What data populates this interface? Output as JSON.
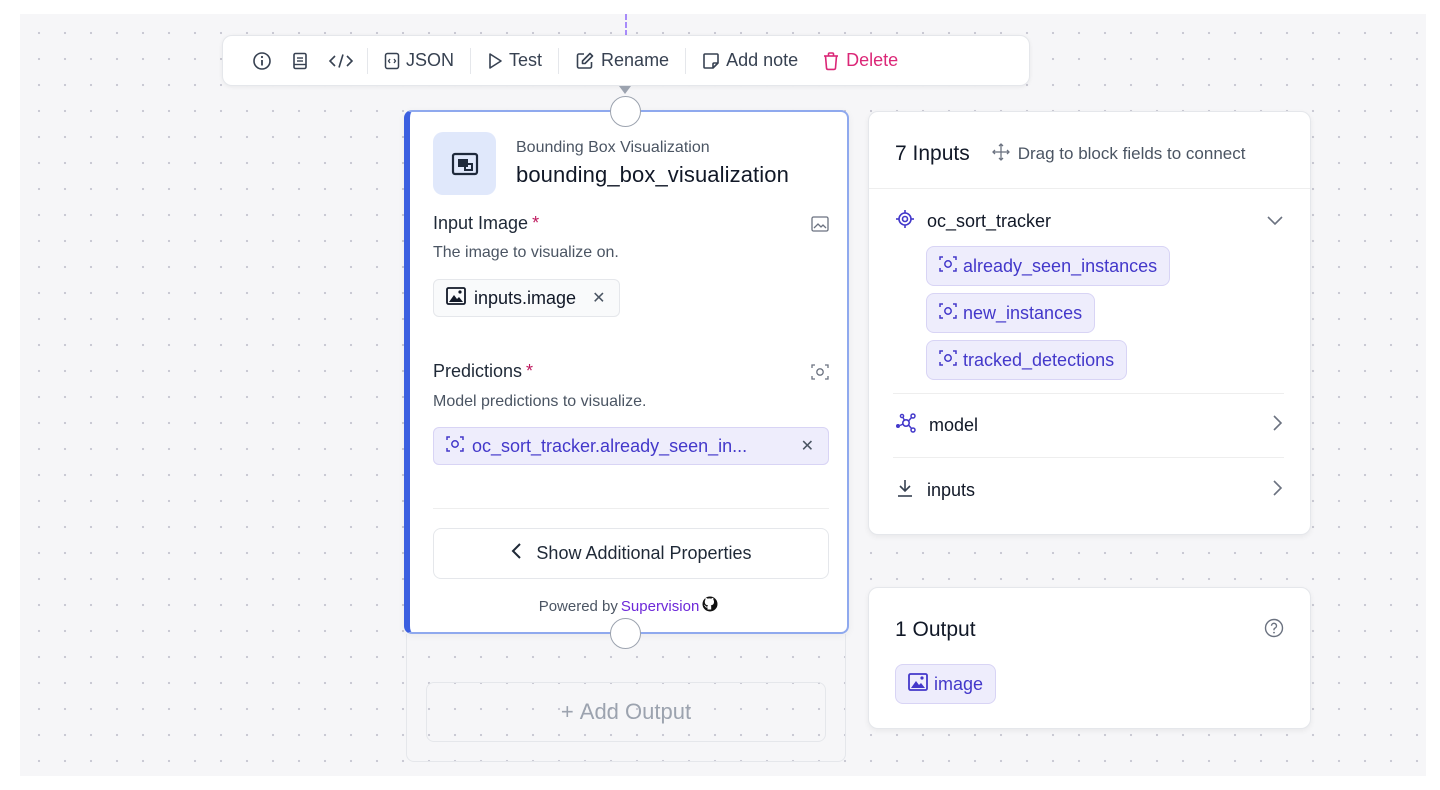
{
  "toolbar": {
    "json_label": "JSON",
    "test_label": "Test",
    "rename_label": "Rename",
    "add_note_label": "Add note",
    "delete_label": "Delete"
  },
  "node": {
    "type_label": "Bounding Box Visualization",
    "name": "bounding_box_visualization",
    "fields": [
      {
        "label": "Input Image",
        "required_mark": "*",
        "description": "The image to visualize on.",
        "value": "inputs.image"
      },
      {
        "label": "Predictions",
        "required_mark": "*",
        "description": "Model predictions to visualize.",
        "value": "oc_sort_tracker.already_seen_in..."
      }
    ],
    "show_more_label": "Show Additional Properties",
    "powered_by_prefix": "Powered by",
    "powered_by_link": "Supervision",
    "add_output_label": "Add Output"
  },
  "inputs_panel": {
    "title": "7 Inputs",
    "hint": "Drag to block fields to connect",
    "groups": [
      {
        "name": "oc_sort_tracker",
        "expanded": true,
        "outputs": [
          "already_seen_instances",
          "new_instances",
          "tracked_detections"
        ]
      },
      {
        "name": "model",
        "expanded": false
      },
      {
        "name": "inputs",
        "expanded": false
      }
    ]
  },
  "output_panel": {
    "title": "1 Output",
    "outputs": [
      "image"
    ]
  },
  "colors": {
    "accent_blue": "#3b5fe0",
    "accent_violet": "#4338ca",
    "danger": "#db2777",
    "canvas": "#f6f6f8"
  }
}
